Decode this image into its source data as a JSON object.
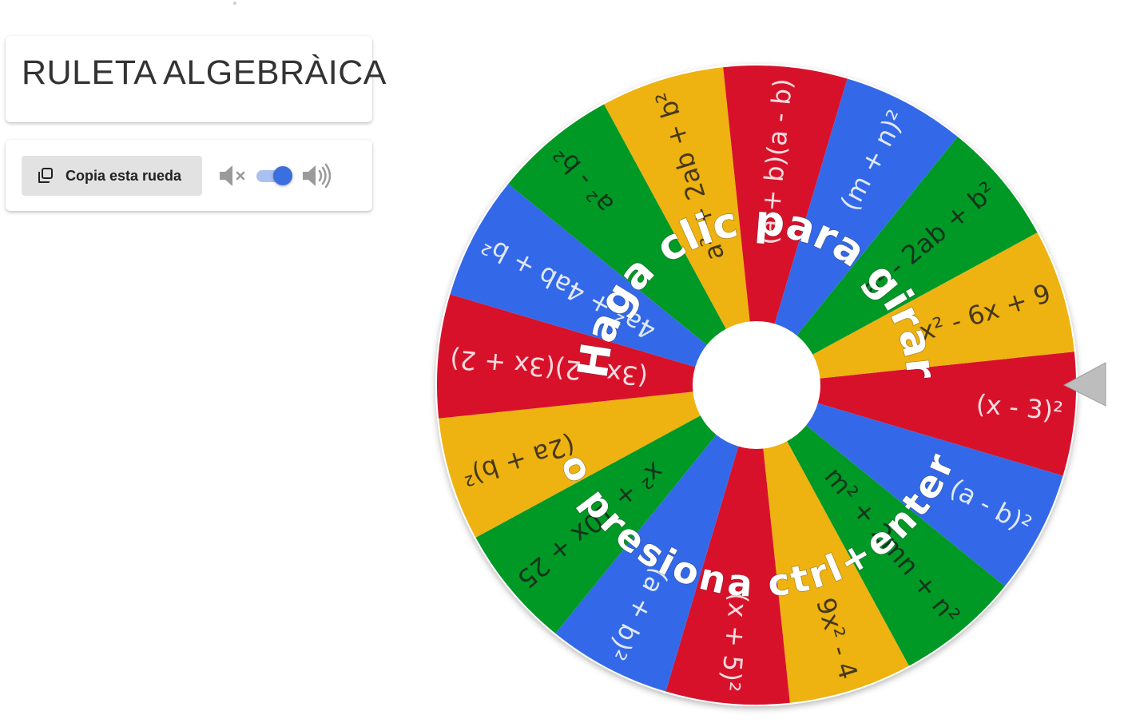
{
  "title": "RULETA ALGEBRÀICA",
  "controls": {
    "copy_label": "Copia esta rueda",
    "copy_icon": "copy-icon",
    "mute_icon": "volume-mute-icon",
    "volume_icon": "volume-up-icon",
    "sound_on": true
  },
  "wheel": {
    "prompt_top": "Haga clic para girar",
    "prompt_bottom": "o presiona ctrl+enter",
    "colors": {
      "red": "#d8112a",
      "blue": "#3369e8",
      "green": "#009925",
      "yellow": "#eeb211",
      "hub": "#ffffff",
      "pointer": "#bdbdbd"
    },
    "segments": [
      {
        "label": "(x - 3)²",
        "color": "red"
      },
      {
        "label": "(a - b)²",
        "color": "blue"
      },
      {
        "label": "m² + 2mn + n²",
        "color": "green"
      },
      {
        "label": "9x² - 4",
        "color": "yellow"
      },
      {
        "label": "(x + 5)²",
        "color": "red"
      },
      {
        "label": "(a + b)²",
        "color": "blue"
      },
      {
        "label": "x² + 10x + 25",
        "color": "green"
      },
      {
        "label": "(2a + b)²",
        "color": "yellow"
      },
      {
        "label": "(3x - 2)(3x + 2)",
        "color": "red"
      },
      {
        "label": "4a² + 4ab + b²",
        "color": "blue"
      },
      {
        "label": "a² - b²",
        "color": "green"
      },
      {
        "label": "a² + 2ab + b²",
        "color": "yellow"
      },
      {
        "label": "(a + b)(a - b)",
        "color": "red"
      },
      {
        "label": "(m + n)²",
        "color": "blue"
      },
      {
        "label": "a² - 2ab + b²",
        "color": "green"
      },
      {
        "label": "x² - 6x + 9",
        "color": "yellow"
      }
    ]
  }
}
